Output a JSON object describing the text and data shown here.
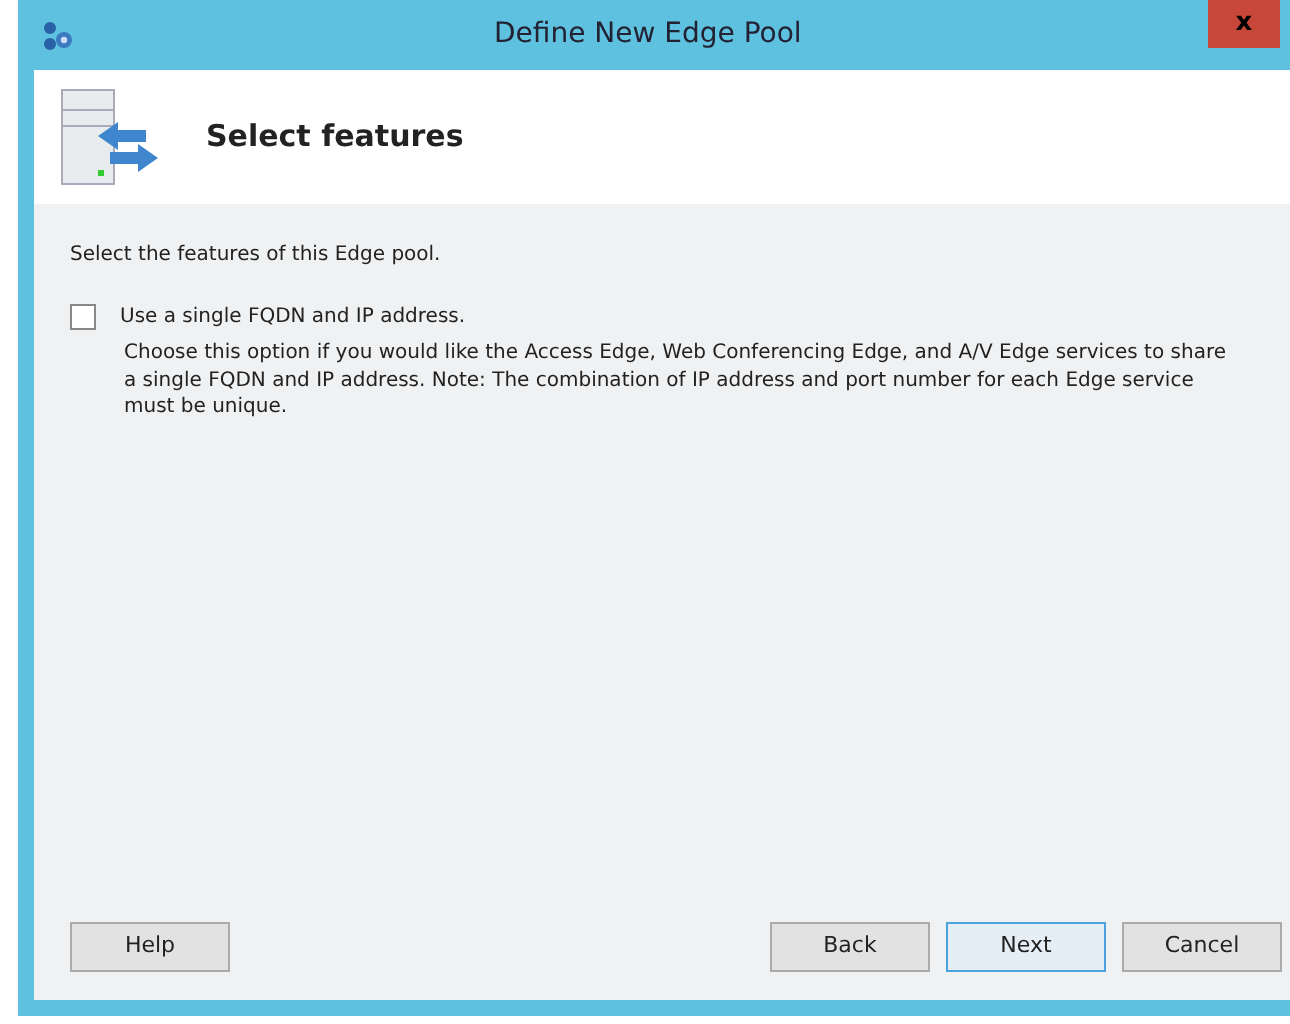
{
  "window": {
    "title": "Define New Edge Pool",
    "close": "x"
  },
  "header": {
    "title": "Select features"
  },
  "intro": "Select the features of this Edge pool.",
  "options": [
    {
      "label": "Use a single FQDN and IP address.",
      "checked": false,
      "description": "Choose this option if you would like the Access Edge, Web Conferencing Edge, and A/V Edge services to share a single FQDN and IP address. Note: The combination of IP address and port number for each Edge service must be unique."
    }
  ],
  "left_buttons": [
    {
      "label": "Help",
      "default": false
    }
  ],
  "right_buttons": [
    {
      "label": "Back",
      "default": false
    },
    {
      "label": "Next",
      "default": true
    },
    {
      "label": "Cancel",
      "default": false
    }
  ]
}
